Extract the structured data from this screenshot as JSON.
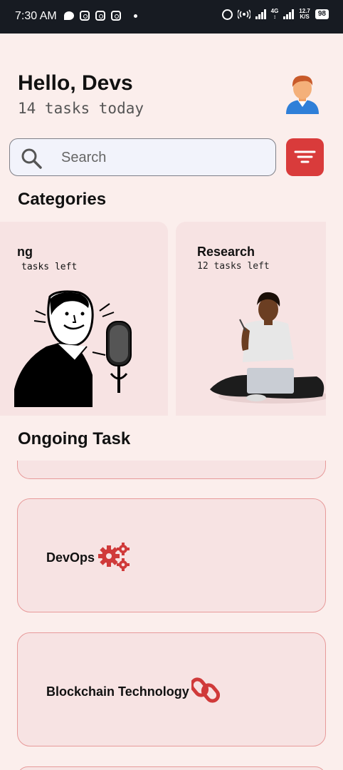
{
  "status_bar": {
    "time": "7:30 AM",
    "network_label_top": "4G",
    "speed_value": "12.7",
    "speed_unit": "K/S",
    "battery": "98",
    "icons": [
      "chat-icon",
      "instagram-icon",
      "instagram-icon",
      "instagram-icon",
      "alarm-icon",
      "hotspot-icon",
      "signal-icon",
      "signal-icon",
      "battery-icon"
    ]
  },
  "header": {
    "greeting": "Hello, Devs",
    "subtitle": "14 tasks today",
    "avatar_icon": "person-avatar-icon"
  },
  "search": {
    "placeholder": "Search",
    "icon": "search-icon"
  },
  "filter": {
    "icon": "filter-icon",
    "color": "#d93b3b"
  },
  "categories": {
    "title": "Categories",
    "items": [
      {
        "name": "ng",
        "count": "tasks left",
        "image": "retro-man-microphone"
      },
      {
        "name": "Research",
        "count": "12 tasks left",
        "image": "woman-with-laptop"
      }
    ]
  },
  "ongoing": {
    "title": "Ongoing Task",
    "tasks": [
      {
        "label": "DevOps",
        "icon": "gears-icon"
      },
      {
        "label": "Blockchain Technology",
        "icon": "chain-link-icon"
      }
    ]
  },
  "colors": {
    "background": "#fbeeec",
    "card": "#f7e3e3",
    "card_border": "#e79a9a",
    "accent": "#d93b3b",
    "status_bar": "#171b22"
  }
}
